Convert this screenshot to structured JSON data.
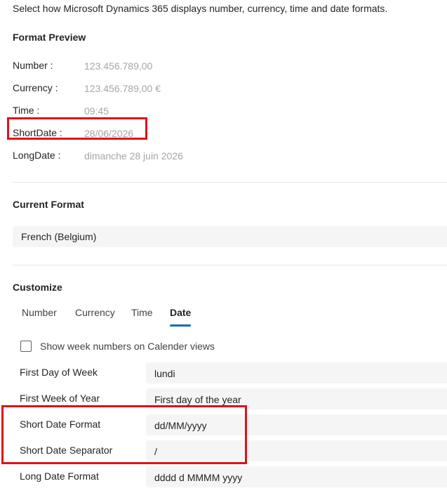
{
  "intro": "Select how Microsoft Dynamics 365 displays number, currency, time and date formats.",
  "preview": {
    "title": "Format Preview",
    "rows": [
      {
        "label": "Number :",
        "value": "123.456.789,00"
      },
      {
        "label": "Currency :",
        "value": "123.456.789,00 €"
      },
      {
        "label": "Time :",
        "value": "09:45"
      },
      {
        "label": "ShortDate :",
        "value": "28/06/2026"
      },
      {
        "label": "LongDate :",
        "value": "dimanche 28 juin 2026"
      }
    ]
  },
  "current_format": {
    "title": "Current Format",
    "value": "French (Belgium)"
  },
  "customize": {
    "title": "Customize",
    "tabs": [
      {
        "label": "Number"
      },
      {
        "label": "Currency"
      },
      {
        "label": "Time"
      },
      {
        "label": "Date",
        "active": true
      }
    ],
    "week_numbers_label": "Show week numbers on Calender views",
    "week_numbers_checked": false,
    "fields": [
      {
        "label": "First Day of Week",
        "value": "lundi"
      },
      {
        "label": "First Week of Year",
        "value": "First day of the year"
      },
      {
        "label": "Short Date Format",
        "value": "dd/MM/yyyy"
      },
      {
        "label": "Short Date Separator",
        "value": "/"
      },
      {
        "label": "Long Date Format",
        "value": "dddd d MMMM yyyy"
      }
    ]
  },
  "colors": {
    "highlight": "#e0101a",
    "accent": "#0f6cbd",
    "field_bg": "#f5f5f5"
  }
}
